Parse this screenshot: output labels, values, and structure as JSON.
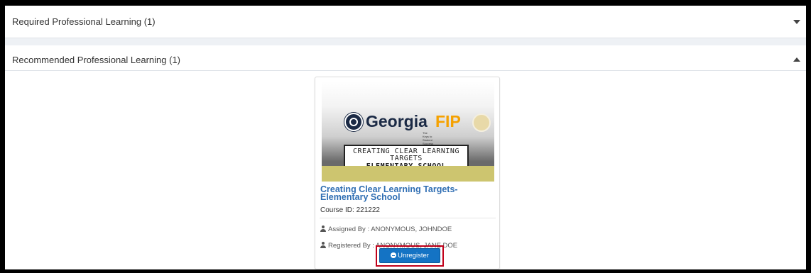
{
  "panels": [
    {
      "title": "Required Professional Learning (1)",
      "state": "collapsed",
      "caret_icon": "caret-down-icon"
    },
    {
      "title": "Recommended Professional Learning (1)",
      "state": "expanded",
      "caret_icon": "caret-up-icon"
    }
  ],
  "card": {
    "thumbnail": {
      "logo_word": "Georgia",
      "logo_accent": "FIP",
      "tagline": "The Keys to Student Success",
      "plate_line1": "CREATING CLEAR LEARNING",
      "plate_line2": "TARGETS",
      "plate_line3": "ELEMENTARY SCHOOL"
    },
    "title": "Creating Clear Learning Targets- Elementary School",
    "course_id_label": "Course ID:",
    "course_id": "221222",
    "assigned_by": "Assigned By : ANONYMOUS, JOHNDOE",
    "registered_by": "Registered By : ANONYMOUS, JANE DOE",
    "unregister_label": "Unregister"
  },
  "colors": {
    "link": "#2f6eb3",
    "button": "#1473c4",
    "highlight": "#c0001a",
    "logo_accent": "#f5a100"
  }
}
